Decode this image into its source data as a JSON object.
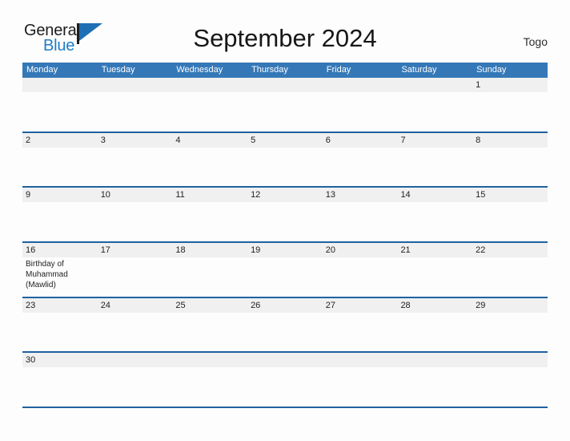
{
  "header": {
    "logo": {
      "word_one": "General",
      "word_two": "Blue",
      "icon": "flag-triangle-icon"
    },
    "title": "September 2024",
    "country": "Togo"
  },
  "colors": {
    "header_blue": "#3578b8",
    "rule_blue": "#1f62a0",
    "band_gray": "#f0f0f0",
    "logo_blue": "#1f7dc4",
    "page_background": "#fdfdfd"
  },
  "calendar": {
    "month": "September",
    "year": "2024",
    "weekday_headers": [
      "Monday",
      "Tuesday",
      "Wednesday",
      "Thursday",
      "Friday",
      "Saturday",
      "Sunday"
    ],
    "weeks": [
      {
        "days": [
          {
            "number": "",
            "events": []
          },
          {
            "number": "",
            "events": []
          },
          {
            "number": "",
            "events": []
          },
          {
            "number": "",
            "events": []
          },
          {
            "number": "",
            "events": []
          },
          {
            "number": "",
            "events": []
          },
          {
            "number": "1",
            "events": []
          }
        ]
      },
      {
        "days": [
          {
            "number": "2",
            "events": []
          },
          {
            "number": "3",
            "events": []
          },
          {
            "number": "4",
            "events": []
          },
          {
            "number": "5",
            "events": []
          },
          {
            "number": "6",
            "events": []
          },
          {
            "number": "7",
            "events": []
          },
          {
            "number": "8",
            "events": []
          }
        ]
      },
      {
        "days": [
          {
            "number": "9",
            "events": []
          },
          {
            "number": "10",
            "events": []
          },
          {
            "number": "11",
            "events": []
          },
          {
            "number": "12",
            "events": []
          },
          {
            "number": "13",
            "events": []
          },
          {
            "number": "14",
            "events": []
          },
          {
            "number": "15",
            "events": []
          }
        ]
      },
      {
        "days": [
          {
            "number": "16",
            "events": [
              "Birthday of Muhammad (Mawlid)"
            ]
          },
          {
            "number": "17",
            "events": []
          },
          {
            "number": "18",
            "events": []
          },
          {
            "number": "19",
            "events": []
          },
          {
            "number": "20",
            "events": []
          },
          {
            "number": "21",
            "events": []
          },
          {
            "number": "22",
            "events": []
          }
        ]
      },
      {
        "days": [
          {
            "number": "23",
            "events": []
          },
          {
            "number": "24",
            "events": []
          },
          {
            "number": "25",
            "events": []
          },
          {
            "number": "26",
            "events": []
          },
          {
            "number": "27",
            "events": []
          },
          {
            "number": "28",
            "events": []
          },
          {
            "number": "29",
            "events": []
          }
        ]
      },
      {
        "days": [
          {
            "number": "30",
            "events": []
          },
          {
            "number": "",
            "events": []
          },
          {
            "number": "",
            "events": []
          },
          {
            "number": "",
            "events": []
          },
          {
            "number": "",
            "events": []
          },
          {
            "number": "",
            "events": []
          },
          {
            "number": "",
            "events": []
          }
        ]
      }
    ]
  }
}
